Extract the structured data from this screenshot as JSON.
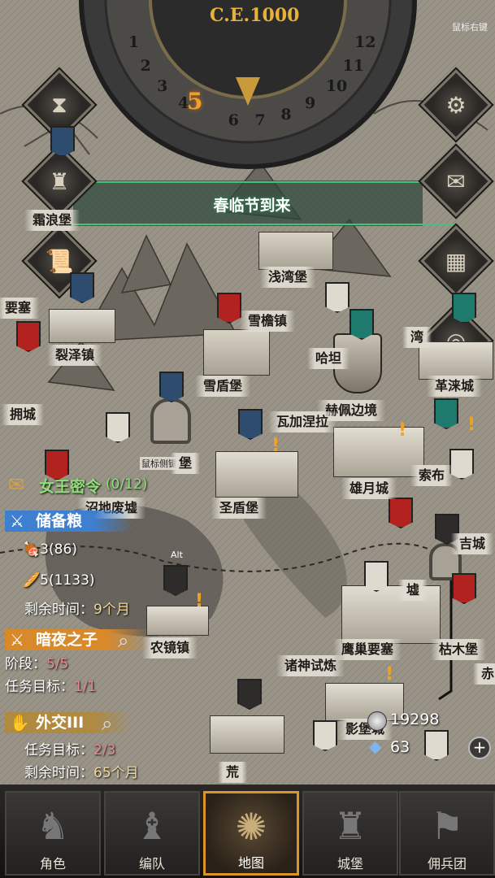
{
  "calendar": {
    "era": "C.E.1000",
    "current_month": "5",
    "months": [
      "1",
      "2",
      "3",
      "4",
      "5",
      "6",
      "7",
      "8",
      "9",
      "10",
      "11",
      "12"
    ]
  },
  "hints": {
    "right_click": "鼠标右键",
    "side_key": "鼠标侧键1",
    "alt": "Alt"
  },
  "event_banner": "春临节到来",
  "locations": {
    "frostwave": "霜浪堡",
    "shallowbay": "浅湾堡",
    "snoweave": "雪檐镇",
    "fortress_partial": "要塞",
    "riftmarsh": "裂泽镇",
    "hath_partial": "哈坦",
    "bay_partial": "湾",
    "gelai": "革涞城",
    "snowshield": "雪盾堡",
    "hepei": "赫佩边境",
    "waga": "瓦加涅拉",
    "yong": "拥城",
    "fortress_locked": "堡",
    "sorn": "索布",
    "xiongyue": "雄月城",
    "marsh_ruins": "沼地废墟",
    "holyshield": "圣盾堡",
    "ruins_partial": "墟",
    "jing_partial": "吉城",
    "nongjing": "农镜镇",
    "eagle_fort": "鹰巢要塞",
    "wood_partial": "枯木堡",
    "zhushen": "诸神试炼",
    "chi_partial": "赤",
    "shadow": "影堡城",
    "huang": "荒"
  },
  "quests": {
    "queen": {
      "title": "女王密令",
      "progress": "(0/12)"
    },
    "reserve": {
      "title": "储备粮",
      "meat": "3",
      "meat_total": "(86)",
      "bread": "5",
      "bread_total": "(1133)",
      "remain_label": "剩余时间：",
      "remain_value": "9个月"
    },
    "night": {
      "title": "暗夜之子",
      "stage_label": "阶段：",
      "stage_value": "5/5",
      "goal_label": "任务目标：",
      "goal_value": "1/1"
    },
    "diplomacy": {
      "title": "外交III",
      "goal_label": "任务目标：",
      "goal_value": "2/3",
      "remain_label": "剩余时间：",
      "remain_value": "65个月"
    }
  },
  "resources": {
    "silver": "19298",
    "crystal": "63"
  },
  "tabs": [
    {
      "label": "角色",
      "icon": "knight-helmet-icon"
    },
    {
      "label": "编队",
      "icon": "party-helmet-icon"
    },
    {
      "label": "地图",
      "icon": "compass-icon"
    },
    {
      "label": "城堡",
      "icon": "castle-icon"
    },
    {
      "label": "佣兵团",
      "icon": "mercenary-banner-icon"
    }
  ],
  "colors": {
    "accent": "#d8952a",
    "event_green": "#3aa86a",
    "reserve_blue": "#3e7fd0",
    "quest_orange": "#d8892a"
  }
}
